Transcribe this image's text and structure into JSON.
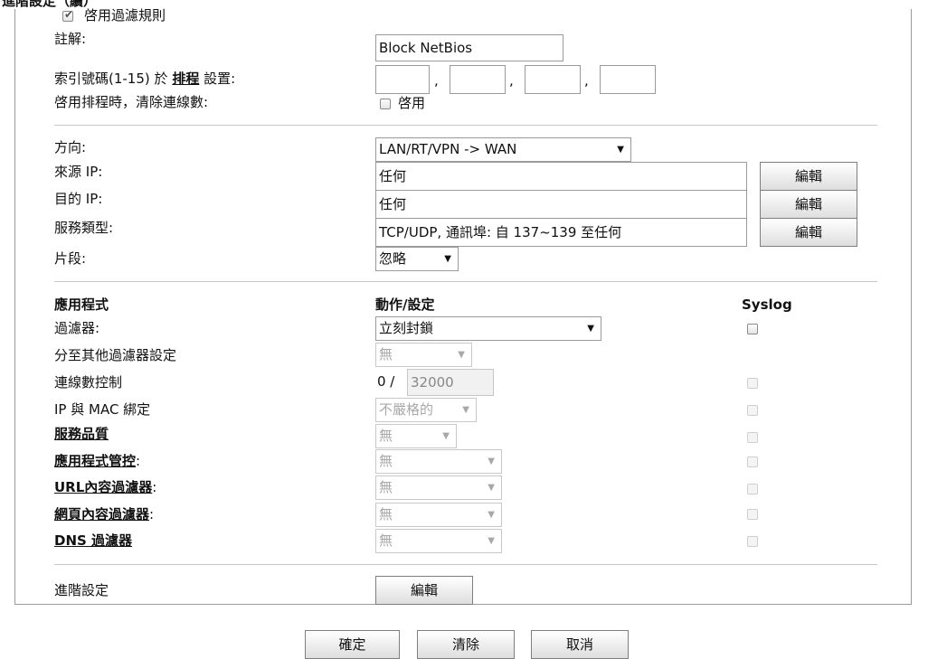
{
  "header_partial": "進階設定（續）",
  "enable_rule": {
    "label": "啓用過濾規則",
    "checked": true
  },
  "comment": {
    "label": "註解:",
    "value": "Block NetBios"
  },
  "schedule": {
    "label_prefix": "索引號碼(1-15) 於",
    "link": "排程",
    "label_suffix": "設置:",
    "values": [
      "",
      "",
      "",
      ""
    ],
    "separators": [
      ",",
      ",",
      ","
    ]
  },
  "clear_sessions": {
    "label": "啓用排程時，清除連線數:",
    "option": "啓用",
    "checked": false
  },
  "direction": {
    "label": "方向:",
    "value": "LAN/RT/VPN -> WAN"
  },
  "source_ip": {
    "label": "來源 IP:",
    "value": "任何",
    "button": "編輯"
  },
  "dest_ip": {
    "label": "目的 IP:",
    "value": "任何",
    "button": "編輯"
  },
  "service_type": {
    "label": "服務類型:",
    "value": "TCP/UDP, 通訊埠: 自 137~139 至任何",
    "button": "編輯"
  },
  "fragments": {
    "label": "片段:",
    "value": "忽略"
  },
  "section": {
    "col1": "應用程式",
    "col2": "動作/設定",
    "col3": "Syslog"
  },
  "filter": {
    "label": "過濾器:",
    "value": "立刻封鎖"
  },
  "branch": {
    "label": "分至其他過濾器設定",
    "value": "無"
  },
  "session_control": {
    "label": "連線數控制",
    "prefix": "0 /",
    "value": "32000"
  },
  "ip_mac": {
    "label": "IP 與 MAC 綁定",
    "value": "不嚴格的"
  },
  "qos": {
    "label": "服務品質",
    "value": "無"
  },
  "app_control": {
    "label": "應用程式管控",
    "colon": ":",
    "value": "無"
  },
  "url_filter": {
    "label": "URL內容過濾器",
    "colon": ":",
    "value": "無"
  },
  "web_filter": {
    "label": "網頁內容過濾器",
    "colon": ":",
    "value": "無"
  },
  "dns_filter": {
    "label": "DNS 過濾器",
    "value": "無"
  },
  "advanced": {
    "label": "進階設定",
    "button": "編輯"
  },
  "footer": {
    "ok": "確定",
    "clear": "清除",
    "cancel": "取消"
  },
  "icons": {
    "dropdown": "▼",
    "check": "✔"
  }
}
